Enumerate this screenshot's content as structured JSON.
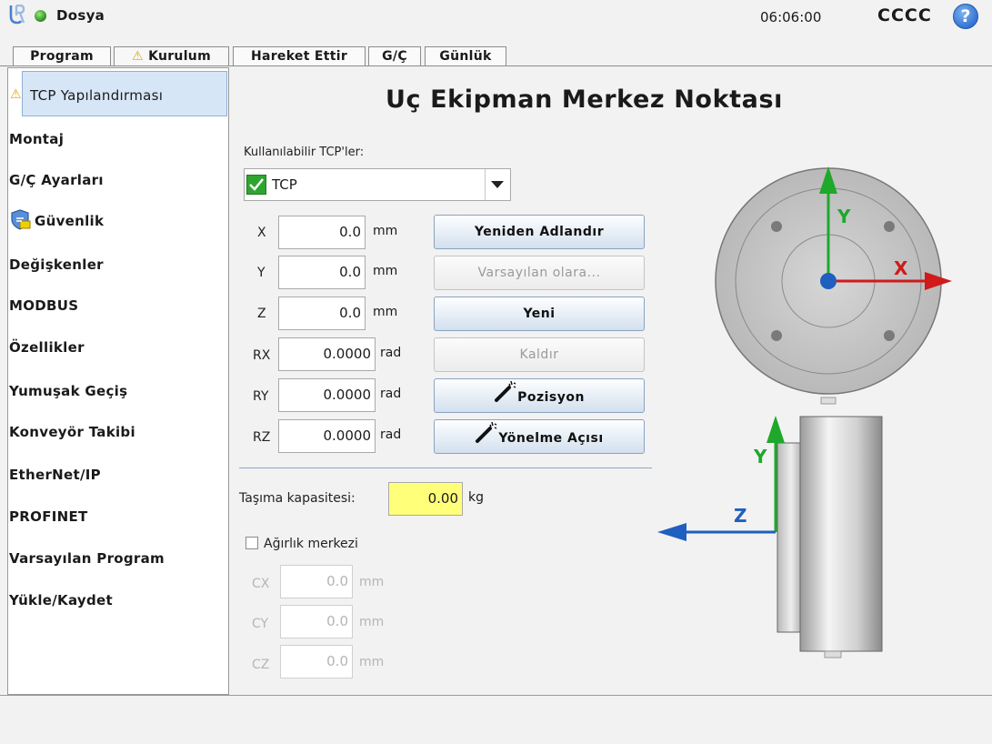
{
  "app": {
    "file_menu": "Dosya",
    "clock": "06:06:00",
    "robot_name": "CCCC",
    "help_symbol": "?"
  },
  "tabs": [
    {
      "label": "Program"
    },
    {
      "label": "Kurulum",
      "warning": true
    },
    {
      "label": "Hareket Ettir"
    },
    {
      "label": "G/Ç"
    },
    {
      "label": "Günlük"
    }
  ],
  "sidebar": {
    "items": [
      {
        "label": "TCP Yapılandırması",
        "selected": true,
        "icon": "warning-icon"
      },
      {
        "label": "Montaj"
      },
      {
        "label": "G/Ç Ayarları"
      },
      {
        "label": "Güvenlik",
        "icon": "safety-shield-icon"
      },
      {
        "label": "Değişkenler"
      },
      {
        "label": "MODBUS"
      },
      {
        "label": "Özellikler"
      },
      {
        "label": "Yumuşak Geçiş"
      },
      {
        "label": "Konveyör Takibi"
      },
      {
        "label": "EtherNet/IP"
      },
      {
        "label": "PROFINET"
      },
      {
        "label": "Varsayılan Program"
      },
      {
        "label": "Yükle/Kaydet"
      }
    ]
  },
  "main": {
    "title": "Uç Ekipman Merkez Noktası",
    "available_tcps_label": "Kullanılabilir TCP'ler:",
    "selected_tcp": "TCP",
    "coords": [
      {
        "axis": "X",
        "value": "0.0",
        "unit": "mm"
      },
      {
        "axis": "Y",
        "value": "0.0",
        "unit": "mm"
      },
      {
        "axis": "Z",
        "value": "0.0",
        "unit": "mm"
      },
      {
        "axis": "RX",
        "value": "0.0000",
        "unit": "rad"
      },
      {
        "axis": "RY",
        "value": "0.0000",
        "unit": "rad"
      },
      {
        "axis": "RZ",
        "value": "0.0000",
        "unit": "rad"
      }
    ],
    "buttons": {
      "rename": "Yeniden Adlandır",
      "set_default": "Varsayılan olara...",
      "new": "Yeni",
      "remove": "Kaldır",
      "position": "Pozisyon",
      "orientation": "Yönelme Açısı"
    },
    "payload_label": "Taşıma kapasitesi:",
    "payload_value": "0.00",
    "payload_unit": "kg",
    "cog_label": "Ağırlık merkezi",
    "cog_checked": false,
    "cog": [
      {
        "axis": "CX",
        "value": "0.0",
        "unit": "mm"
      },
      {
        "axis": "CY",
        "value": "0.0",
        "unit": "mm"
      },
      {
        "axis": "CZ",
        "value": "0.0",
        "unit": "mm"
      }
    ],
    "diagram": {
      "label_x": "X",
      "label_y_top": "Y",
      "label_y_side": "Y",
      "label_z": "Z"
    }
  },
  "colors": {
    "accent_blue": "#1f5fbf",
    "axis_red": "#d11a1a",
    "axis_green": "#1fa82b",
    "payload_yellow": "#ffff7a",
    "selected_bg": "#d7e6f7"
  }
}
